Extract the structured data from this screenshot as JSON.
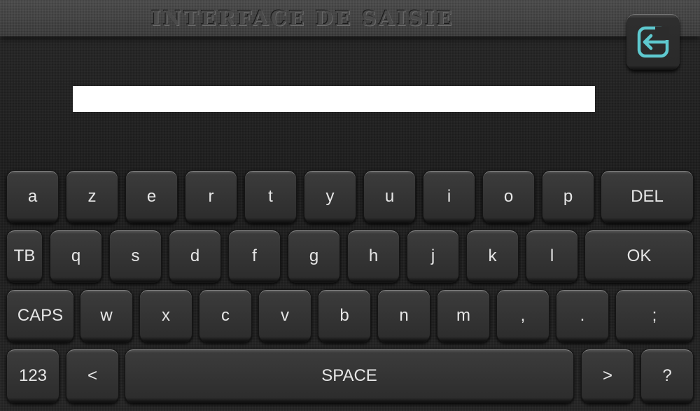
{
  "header": {
    "title": "INTERFACE DE SAISIE",
    "exit_icon": "exit-icon",
    "exit_icon_color": "#5ec9cf"
  },
  "input": {
    "value": "",
    "placeholder": ""
  },
  "keyboard": {
    "row1": {
      "a": "a",
      "z": "z",
      "e": "e",
      "r": "r",
      "t": "t",
      "y": "y",
      "u": "u",
      "i": "i",
      "o": "o",
      "p": "p",
      "del": "DEL"
    },
    "row2": {
      "tab": "TB",
      "q": "q",
      "s": "s",
      "d": "d",
      "f": "f",
      "g": "g",
      "h": "h",
      "j": "j",
      "k": "k",
      "l": "l",
      "ok": "OK"
    },
    "row3": {
      "caps": "CAPS",
      "w": "w",
      "x": "x",
      "c": "c",
      "v": "v",
      "b": "b",
      "n": "n",
      "m": "m",
      "comma": ",",
      "period": ".",
      "semicolon": ";"
    },
    "row4": {
      "numbers": "123",
      "left": "<",
      "space": "SPACE",
      "right": ">",
      "question": "?"
    }
  }
}
